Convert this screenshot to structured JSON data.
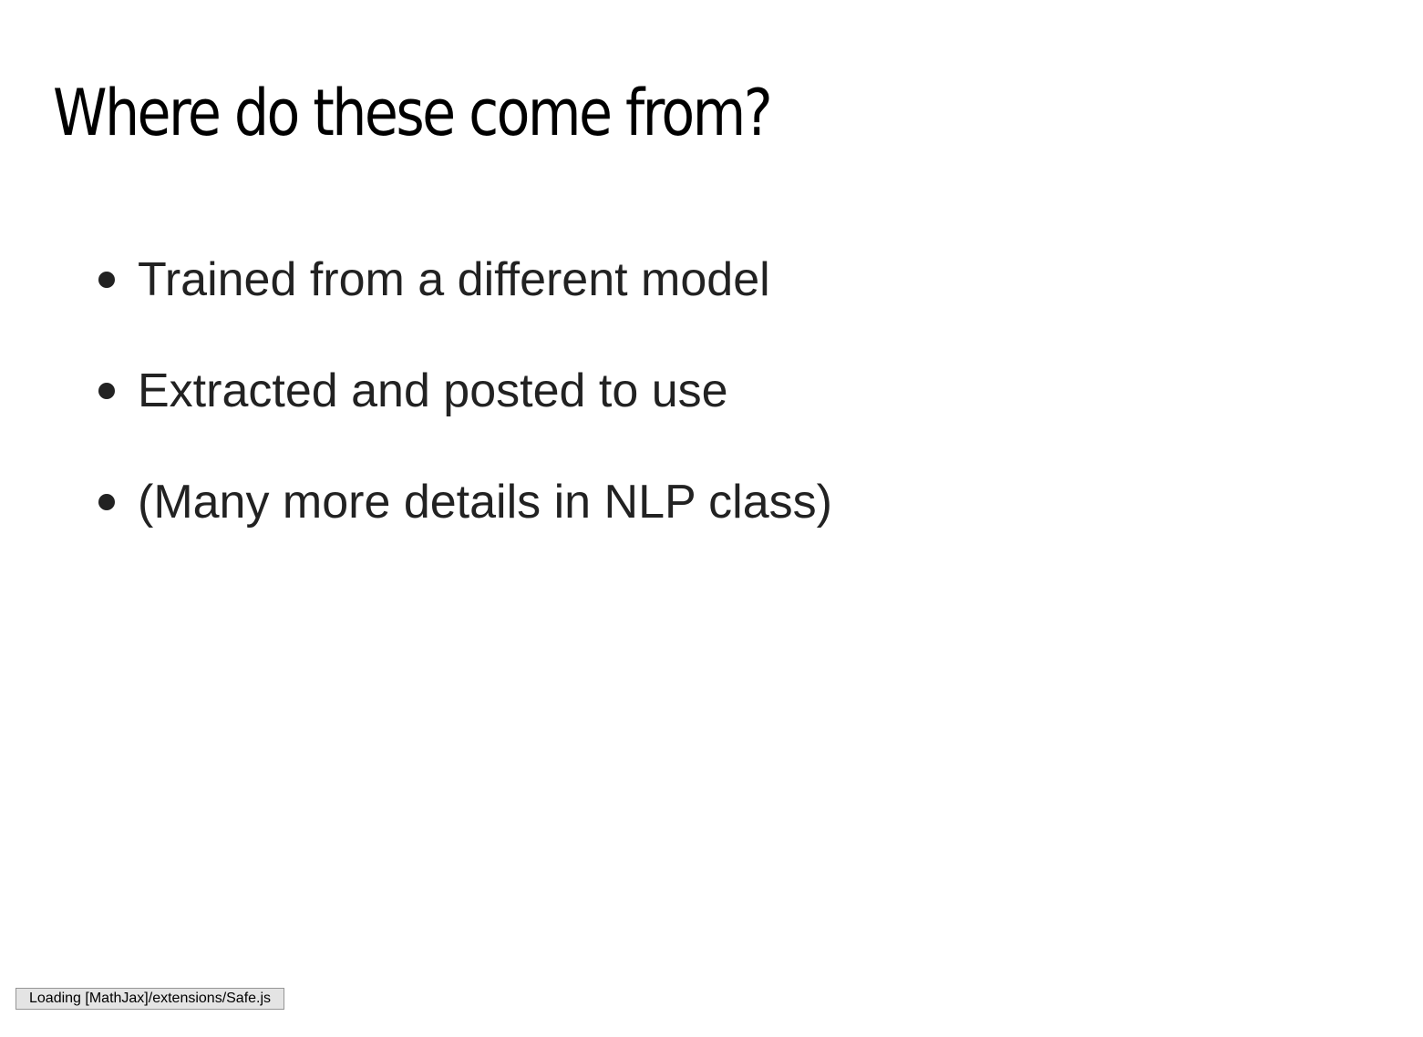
{
  "slide": {
    "title": "Where do these come from?",
    "bullets": [
      "Trained from a different model",
      "Extracted and posted to use",
      "(Many more details in NLP class)"
    ]
  },
  "status_message": "Loading [MathJax]/extensions/Safe.js"
}
